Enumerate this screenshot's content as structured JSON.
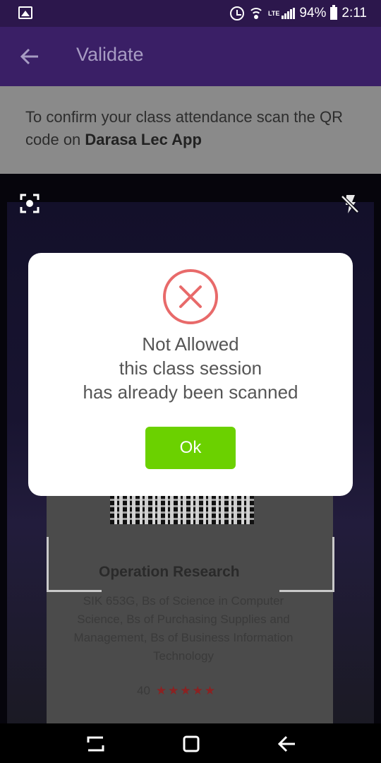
{
  "status_bar": {
    "network": "LTE",
    "battery": "94%",
    "time": "2:11",
    "icons": [
      "gallery-icon",
      "alarm-icon",
      "wifi-icon",
      "signal-icon",
      "battery-icon"
    ]
  },
  "app_bar": {
    "title": "Validate",
    "back_icon": "arrow-left-icon"
  },
  "instruction": {
    "text": "To confirm your class attendance scan the QR code on ",
    "app_name": "Darasa Lec App"
  },
  "camera": {
    "left_icon": "focus-scan-icon",
    "right_icon": "flash-off-icon",
    "card": {
      "title": "Operation Research",
      "description": "SIK 653G, Bs of Science in Computer Science, Bs of Purchasing Supplies and Management, Bs of Business Information Technology",
      "count": "40",
      "stars": "★★★★★"
    }
  },
  "dialog": {
    "icon": "error-x-icon",
    "title": "Not Allowed",
    "line2": "this class session",
    "line3": "has already been scanned",
    "ok_label": "Ok",
    "colors": {
      "error": "#e86a6a",
      "ok": "#6bd100"
    }
  },
  "nav_bar": {
    "icons": [
      "recents-icon",
      "home-icon",
      "back-icon"
    ]
  },
  "colors": {
    "status_bar": "#2c174c",
    "app_bar": "#3a1f66",
    "instruction_bg": "#8a8a8a"
  }
}
